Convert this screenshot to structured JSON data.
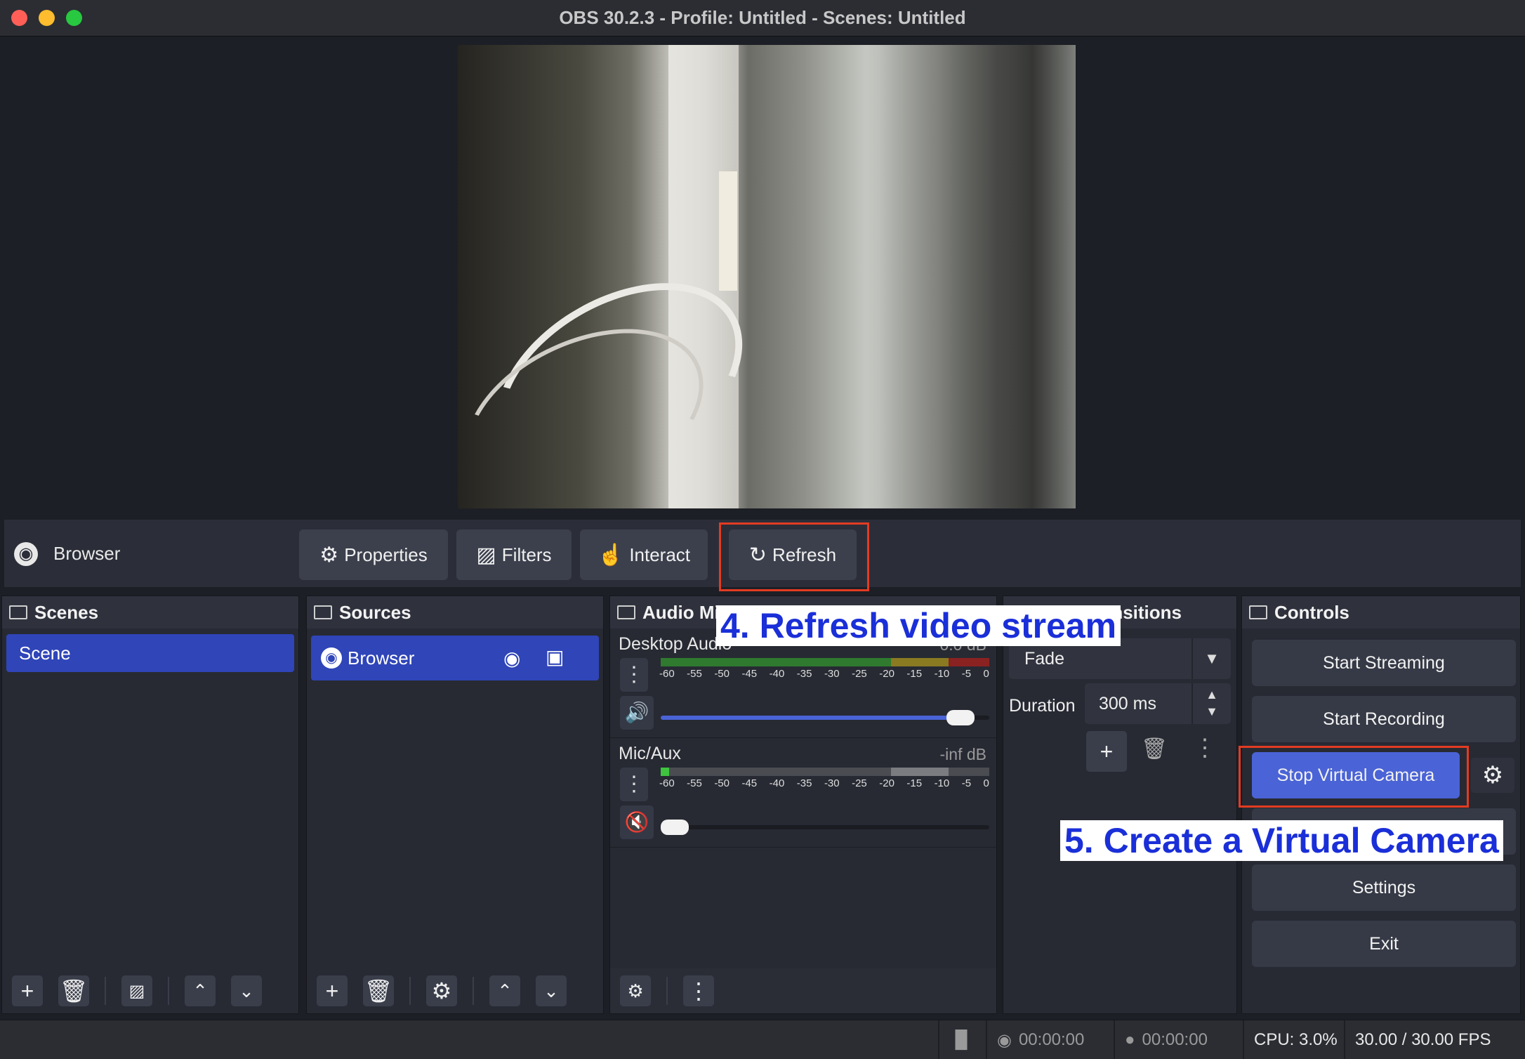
{
  "window": {
    "title": "OBS 30.2.3 - Profile: Untitled - Scenes: Untitled"
  },
  "source_toolbar": {
    "source_name": "Browser",
    "properties_label": "Properties",
    "filters_label": "Filters",
    "interact_label": "Interact",
    "refresh_label": "Refresh"
  },
  "annotations": {
    "refresh_note": "4. Refresh video stream",
    "vcam_note": "5. Create a Virtual Camera"
  },
  "scenes": {
    "title": "Scenes",
    "items": [
      "Scene"
    ]
  },
  "sources": {
    "title": "Sources",
    "items": [
      "Browser"
    ]
  },
  "audio_mixer": {
    "title": "Audio Mix",
    "ticks": [
      "-60",
      "-55",
      "-50",
      "-45",
      "-40",
      "-35",
      "-30",
      "-25",
      "-20",
      "-15",
      "-10",
      "-5",
      "0"
    ],
    "channels": [
      {
        "name": "Desktop Audio",
        "db": "0.0 dB",
        "volume": 0.95,
        "muted": false
      },
      {
        "name": "Mic/Aux",
        "db": "-inf dB",
        "volume": 0.0,
        "muted": true
      }
    ]
  },
  "transitions": {
    "title": "nsitions",
    "selected": "Fade",
    "duration_label": "Duration",
    "duration_value": "300 ms"
  },
  "controls": {
    "title": "Controls",
    "start_streaming": "Start Streaming",
    "start_recording": "Start Recording",
    "stop_virtual_camera": "Stop Virtual Camera",
    "settings": "Settings",
    "exit": "Exit"
  },
  "status_bar": {
    "stream_time": "00:00:00",
    "record_time": "00:00:00",
    "cpu": "CPU: 3.0%",
    "fps": "30.00 / 30.00 FPS"
  },
  "colors": {
    "accent": "#2f45b8",
    "vcam_button": "#4a63d6",
    "highlight_box": "#e33b22",
    "annotation_text": "#1a2fd8"
  }
}
